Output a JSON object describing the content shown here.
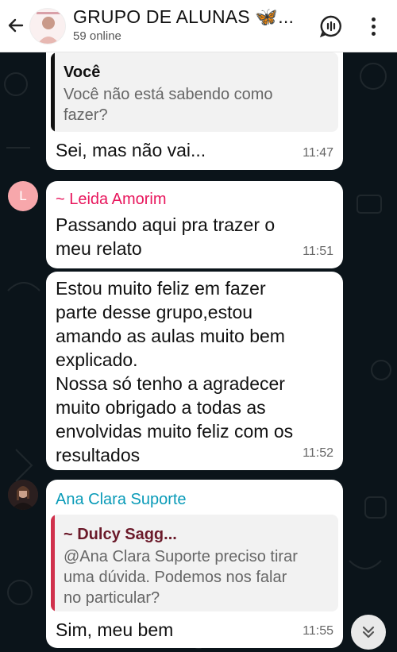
{
  "header": {
    "title": "GRUPO DE ALUNAS 🦋...",
    "subtitle": "59 online"
  },
  "messages": [
    {
      "quote_author": "Você",
      "quote_text_line1": "Você não está sabendo como",
      "quote_text_line2": "fazer?",
      "text": "Sei, mas não vai...",
      "time": "11:47"
    },
    {
      "sender": "~ Leida Amorim",
      "avatar_letter": "L",
      "line1": "Passando aqui pra trazer o",
      "line2": "meu relato",
      "time": "11:51"
    },
    {
      "lines": [
        "Estou muito feliz em fazer",
        "parte desse grupo,estou",
        "amando as aulas muito bem",
        "explicado.",
        "Nossa só tenho a agradecer",
        "muito obrigado a todas as",
        "envolvidas muito feliz com os",
        "resultados"
      ],
      "time": "11:52"
    },
    {
      "sender": "Ana Clara Suporte",
      "quote_author": "~ Dulcy Sagg...",
      "quote_text_line1": "@Ana Clara Suporte preciso tirar",
      "quote_text_line2": "uma dúvida. Podemos nos falar",
      "quote_text_line3": "no particular?",
      "text": "Sim, meu bem",
      "time": "11:55"
    }
  ],
  "colors": {
    "leida_name": "#e8175d",
    "ana_name": "#0a9bb8",
    "dulcy_name": "#6b1a2a",
    "quote_bar_self": "#111111",
    "quote_bar_dulcy": "#d0314c",
    "leida_avatar_bg": "#f7a7ab"
  },
  "icons": {
    "back": "arrow-left-icon",
    "call": "group-call-icon",
    "menu": "more-vertical-icon",
    "scroll": "double-chevron-down-icon"
  }
}
